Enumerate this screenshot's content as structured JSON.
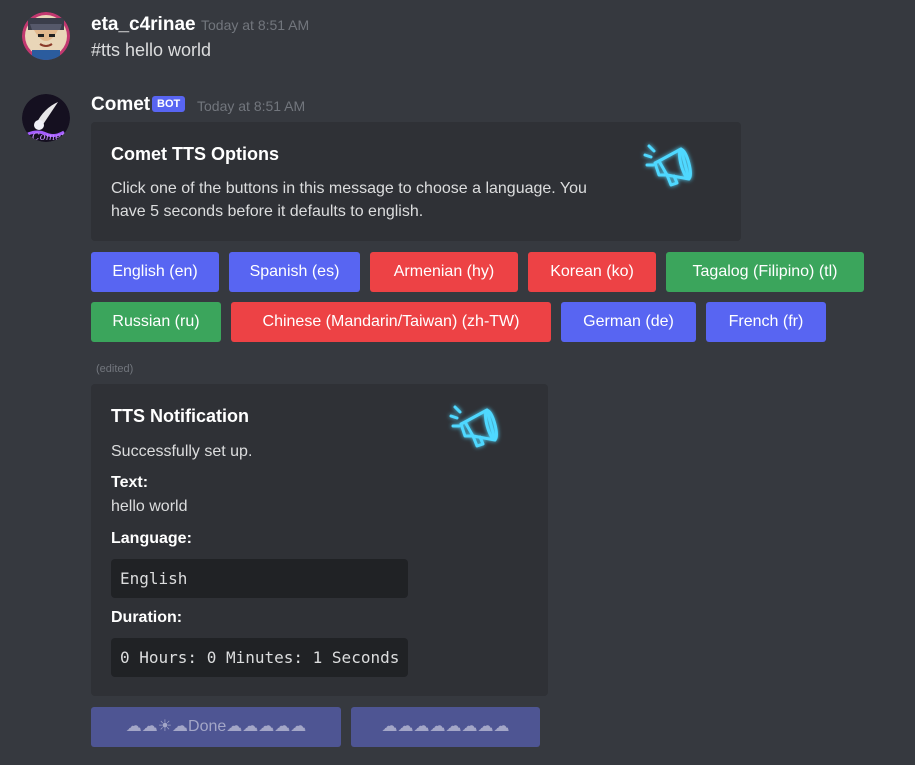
{
  "message1": {
    "username": "eta_c4rinae",
    "timestamp": "Today at 8:51 AM",
    "content": "#tts hello world",
    "avatar_icon": "anime-character-avatar-icon"
  },
  "message2": {
    "username": "Comet",
    "bot_badge": "BOT",
    "timestamp": "Today at 8:51 AM",
    "avatar_icon": "comet-avatar-icon"
  },
  "embed1": {
    "title": "Comet TTS Options",
    "description": "Click one of the buttons in this message to choose a language. You have 5 seconds before it defaults to english.",
    "thumbnail_icon": "megaphone-icon"
  },
  "buttons_row1": [
    {
      "label": "English (en)",
      "style": "blurple"
    },
    {
      "label": "Spanish (es)",
      "style": "blurple"
    },
    {
      "label": "Armenian (hy)",
      "style": "red"
    },
    {
      "label": "Korean (ko)",
      "style": "red"
    },
    {
      "label": "Tagalog (Filipino) (tl)",
      "style": "green"
    }
  ],
  "buttons_row2": [
    {
      "label": "Russian (ru)",
      "style": "green"
    },
    {
      "label": "Chinese (Mandarin/Taiwan) (zh-TW)",
      "style": "red"
    },
    {
      "label": "German (de)",
      "style": "blurple"
    },
    {
      "label": "French (fr)",
      "style": "blurple"
    }
  ],
  "edited_label": "(edited)",
  "embed2": {
    "title": "TTS Notification",
    "description": "Successfully set up.",
    "thumbnail_icon": "megaphone-icon",
    "field_text_name": "Text:",
    "field_text_value": "hello world",
    "field_language_name": "Language:",
    "field_language_value": "English",
    "field_duration_name": "Duration:",
    "field_duration_value": "0 Hours: 0 Minutes: 1 Seconds"
  },
  "progress_buttons": {
    "done_label": "☁☁☀☁Done☁☁☁☁☁",
    "pending_label": "☁☁☁☁☁☁☁☁"
  },
  "colors": {
    "background": "#36393f",
    "embed_background": "#2f3136",
    "blurple": "#5865f2",
    "red": "#ed4245",
    "green": "#3ba55c"
  }
}
